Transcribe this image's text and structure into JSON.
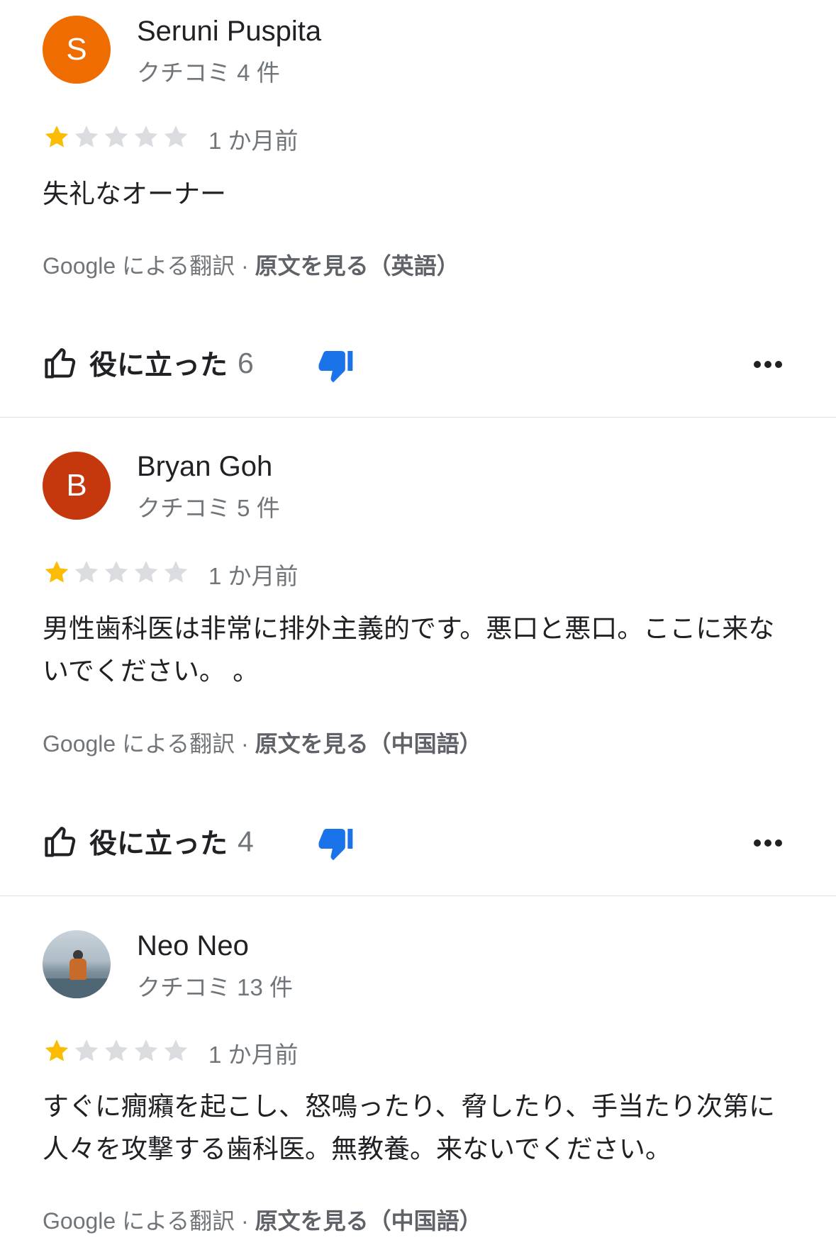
{
  "colors": {
    "star_filled": "#fbbc04",
    "star_empty": "#dadce0",
    "dislike_active": "#1a73e8",
    "avatar_s": "#ef6c00",
    "avatar_b": "#c5380e"
  },
  "icons": {
    "thumb_up": "thumb-up-icon",
    "thumb_down": "thumb-down-icon",
    "more": "more-horiz-icon"
  },
  "reviews": [
    {
      "avatar_letter": "S",
      "author": "Seruni Puspita",
      "review_count": "クチコミ 4 件",
      "rating": 1,
      "time": "1 か月前",
      "text": "失礼なオーナー",
      "translated_by": "Google による翻訳 · ",
      "original_link": "原文を見る（英語）",
      "helpful_label": "役に立った",
      "helpful_count": "6"
    },
    {
      "avatar_letter": "B",
      "author": "Bryan Goh",
      "review_count": "クチコミ 5 件",
      "rating": 1,
      "time": "1 か月前",
      "text": "男性歯科医は非常に排外主義的です。悪口と悪口。ここに来ないでください。 。",
      "translated_by": "Google による翻訳 · ",
      "original_link": "原文を見る（中国語）",
      "helpful_label": "役に立った",
      "helpful_count": "4"
    },
    {
      "avatar_letter": "",
      "author": "Neo Neo",
      "review_count": "クチコミ 13 件",
      "rating": 1,
      "time": "1 か月前",
      "text": "すぐに癇癪を起こし、怒鳴ったり、脅したり、手当たり次第に人々を攻撃する歯科医。無教養。来ないでください。",
      "translated_by": "Google による翻訳 · ",
      "original_link": "原文を見る（中国語）"
    }
  ]
}
